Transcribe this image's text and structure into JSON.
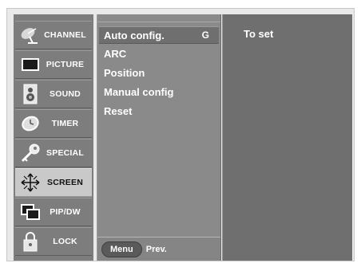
{
  "side_menu": {
    "items": [
      {
        "label": "CHANNEL",
        "icon": "satellite-dish-icon"
      },
      {
        "label": "PICTURE",
        "icon": "monitor-icon"
      },
      {
        "label": "SOUND",
        "icon": "speaker-icon"
      },
      {
        "label": "TIMER",
        "icon": "clock-icon"
      },
      {
        "label": "SPECIAL",
        "icon": "key-icon"
      },
      {
        "label": "SCREEN",
        "icon": "screen-arrows-icon"
      },
      {
        "label": "PIP/DW",
        "icon": "pip-icon"
      },
      {
        "label": "LOCK",
        "icon": "padlock-icon"
      }
    ],
    "active_index": 5
  },
  "submenu": {
    "items": [
      {
        "label": "Auto config.",
        "arrow": "G"
      },
      {
        "label": "ARC"
      },
      {
        "label": "Position"
      },
      {
        "label": "Manual config"
      },
      {
        "label": "Reset"
      }
    ],
    "selected_index": 0,
    "footer": {
      "menu_label": "Menu",
      "prev_label": "Prev."
    }
  },
  "info_pane": {
    "text": "To set"
  },
  "colors": {
    "panel": "#7d7d7d",
    "active": "#c9c9c9",
    "info": "#6f6f6f",
    "text": "#ffffff"
  }
}
